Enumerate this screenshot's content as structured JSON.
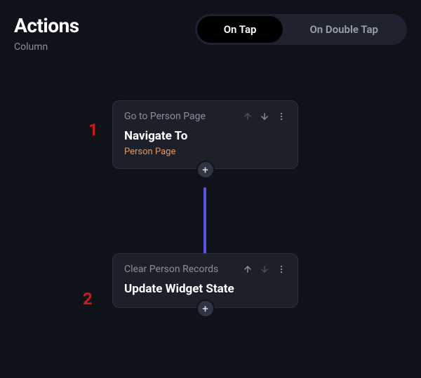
{
  "header": {
    "title": "Actions",
    "subtitle": "Column"
  },
  "tabs": {
    "active": "On Tap",
    "inactive": "On Double Tap"
  },
  "annotations": {
    "first": "1",
    "second": "2"
  },
  "nodes": [
    {
      "label": "Go to Person Page",
      "title": "Navigate To",
      "target": "Person Page"
    },
    {
      "label": "Clear Person Records",
      "title": "Update Widget State",
      "target": ""
    }
  ],
  "icons": {
    "plus": "+"
  }
}
